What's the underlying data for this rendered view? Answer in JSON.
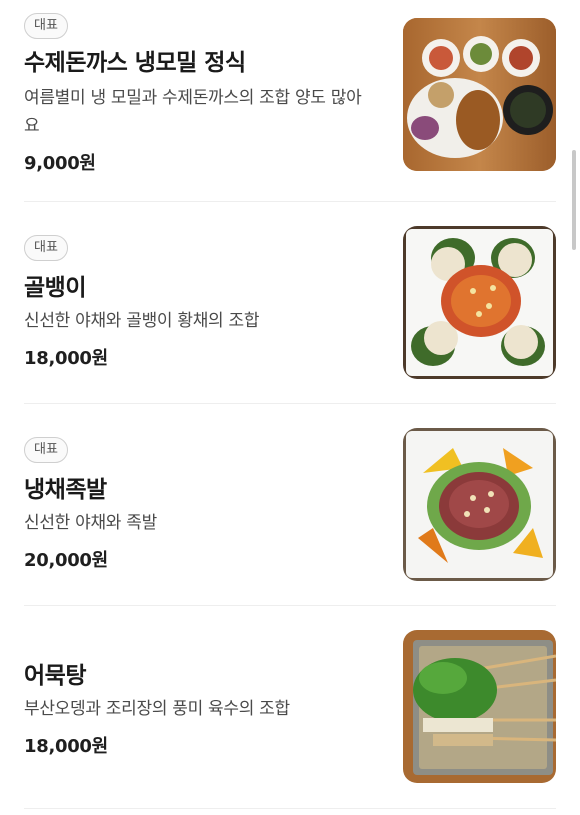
{
  "menu": {
    "items": [
      {
        "badge": "대표",
        "name": "수제돈까스 냉모밀 정식",
        "description": "여름별미 냉 모밀과 수제돈까스의 조합 양도 많아요",
        "price": "9,000원",
        "image": "pork-cutlet-cold-soba-photo"
      },
      {
        "badge": "대표",
        "name": "골뱅이",
        "description": "신선한 야채와 골뱅이 황채의 조합",
        "price": "18,000원",
        "image": "whelk-salad-photo"
      },
      {
        "badge": "대표",
        "name": "냉채족발",
        "description": "신선한 야채와 족발",
        "price": "20,000원",
        "image": "cold-pork-trotters-salad-photo"
      },
      {
        "badge": "",
        "name": "어묵탕",
        "description": "부산오뎅과 조리장의 풍미 육수의 조합",
        "price": "18,000원",
        "image": "fish-cake-soup-photo"
      }
    ]
  }
}
